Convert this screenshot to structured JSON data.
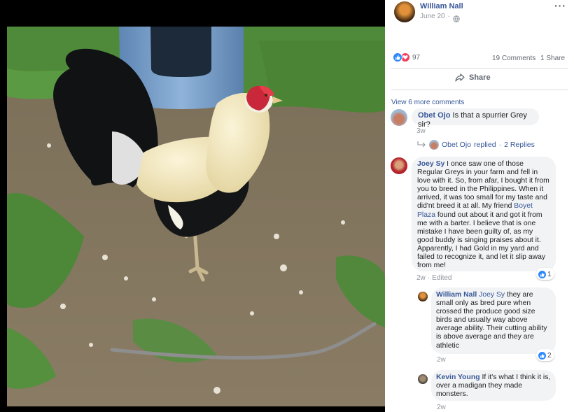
{
  "post": {
    "author": "William Nall",
    "date": "June 20",
    "privacy_icon": "globe-icon",
    "more_icon": "ellipsis-icon"
  },
  "stats": {
    "reactions_count": "97",
    "comments_count": "19 Comments",
    "shares_count": "1 Share"
  },
  "actions": {
    "share_label": "Share"
  },
  "comments_nav": {
    "view_more": "View 6 more comments"
  },
  "comments": [
    {
      "author": "Obet Ojo",
      "text": "Is that a spurrier Grey sir?",
      "time": "3w",
      "reply_author": "Obet Ojo",
      "reply_action": "replied",
      "reply_separator": "·",
      "reply_count": "2 Replies"
    },
    {
      "author": "Joey Sy",
      "text_part1": "I once saw one of those Regular Greys in your farm and fell in love with it. So, from afar, I bought it from you to breed in the Philippines. When it arrived, it was too small for my taste and did'nt breed it at all. My friend",
      "mention": "Boyet Plaza",
      "text_part2": "found out about it and got it from me with a barter. I believe that is one mistake I have been guilty of, as my good buddy is singing praises about it. Apparently, I had Gold in my yard and failed to recognize it, and let it slip away from me!",
      "time": "2w",
      "edited": "Edited",
      "likes": "1"
    }
  ],
  "replies": [
    {
      "author": "William Nall",
      "mention": "Joey Sy",
      "text": "they are small only as bred pure when crossed the produce good size birds and usually way above average ability. Their cutting ability is above average and they are athletic",
      "time": "2w",
      "likes": "2"
    },
    {
      "author": "Kevin Young",
      "text": "If it's what I think it is, over a madigan they made monsters.",
      "time": "2w"
    }
  ],
  "colors": {
    "link": "#385898",
    "meta": "#90949c",
    "bubble": "#f2f3f5",
    "like_blue": "#2d88ff",
    "love_red": "#f33e58"
  }
}
